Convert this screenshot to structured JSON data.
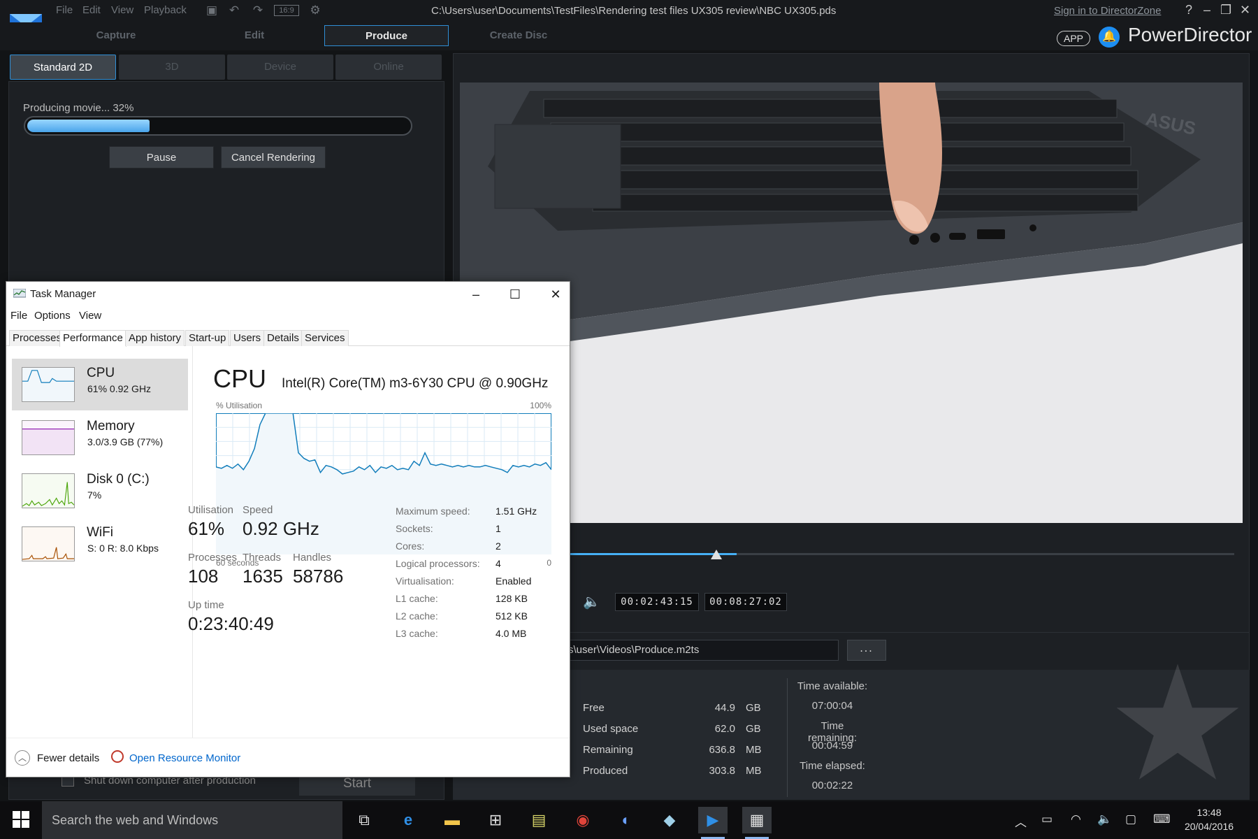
{
  "powerdirector": {
    "menu": [
      "File",
      "Edit",
      "View",
      "Playback"
    ],
    "aspect_ratio": "16:9",
    "file_path": "C:\\Users\\user\\Documents\\TestFiles\\Rendering test files UX305 review\\NBC UX305.pds",
    "sign_in": "Sign in to DirectorZone",
    "help": "?",
    "modes": [
      "Capture",
      "Edit",
      "Produce",
      "Create Disc"
    ],
    "active_mode": "Produce",
    "app_badge": "APP",
    "brand": "PowerDirector",
    "subtabs": [
      "Standard 2D",
      "3D",
      "Device",
      "Online"
    ],
    "progress": {
      "label": "Producing movie... 32%",
      "percent": 32
    },
    "pause_label": "Pause",
    "cancel_label": "Cancel Rendering",
    "shutdown_label": "Shut down computer after production",
    "start_label": "Start",
    "seek_fraction": 0.25,
    "timecode_current": "00:02:43:15",
    "timecode_total": "00:08:27:02",
    "output_path": "s\\user\\Videos\\Produce.m2ts",
    "browse_label": "...",
    "disk_info": [
      {
        "label": "Free",
        "value": "44.9",
        "unit": "GB"
      },
      {
        "label": "Used space",
        "value": "62.0",
        "unit": "GB"
      },
      {
        "label": "Remaining",
        "value": "636.8",
        "unit": "MB"
      },
      {
        "label": "Produced",
        "value": "303.8",
        "unit": "MB"
      }
    ],
    "time_info": [
      {
        "label": "Time available:",
        "value": "07:00:04"
      },
      {
        "label": "Time remaining:",
        "value": "00:04:59"
      },
      {
        "label": "Time elapsed:",
        "value": "00:02:22"
      }
    ]
  },
  "task_manager": {
    "title": "Task Manager",
    "menu": [
      "File",
      "Options",
      "View"
    ],
    "tabs": [
      "Processes",
      "Performance",
      "App history",
      "Start-up",
      "Users",
      "Details",
      "Services"
    ],
    "active_tab": "Performance",
    "sidebar": [
      {
        "name": "CPU",
        "sub": "61%  0.92 GHz",
        "color": "#117dbb"
      },
      {
        "name": "Memory",
        "sub": "3.0/3.9 GB (77%)",
        "color": "#8b12ae"
      },
      {
        "name": "Disk 0 (C:)",
        "sub": "7%",
        "color": "#4da60c"
      },
      {
        "name": "WiFi",
        "sub": "S: 0  R: 8.0 Kbps",
        "color": "#a74f01"
      }
    ],
    "cpu": {
      "title": "CPU",
      "model": "Intel(R) Core(TM) m3-6Y30 CPU @ 0.90GHz",
      "graph_label": "% Utilisation",
      "graph_max": "100%",
      "graph_left": "60 seconds",
      "graph_right": "0",
      "graph_values": [
        62,
        61,
        63,
        61,
        64,
        60,
        66,
        75,
        92,
        100,
        100,
        100,
        100,
        100,
        100,
        72,
        68,
        66,
        67,
        58,
        63,
        62,
        60,
        57,
        58,
        59,
        62,
        60,
        63,
        58,
        62,
        61,
        63,
        60,
        61,
        60,
        66,
        63,
        72,
        64,
        63,
        64,
        63,
        62,
        63,
        62,
        63,
        62,
        62,
        63,
        62,
        61,
        60,
        58,
        63,
        62,
        63,
        62,
        64,
        63,
        65,
        60
      ],
      "stats": [
        {
          "label": "Utilisation",
          "value": "61%"
        },
        {
          "label": "Speed",
          "value": "0.92 GHz"
        },
        {
          "label": "Processes",
          "value": "108"
        },
        {
          "label": "Threads",
          "value": "1635"
        },
        {
          "label": "Handles",
          "value": "58786"
        },
        {
          "label": "Up time",
          "value": "0:23:40:49"
        }
      ],
      "specs": [
        {
          "label": "Maximum speed:",
          "value": "1.51 GHz"
        },
        {
          "label": "Sockets:",
          "value": "1"
        },
        {
          "label": "Cores:",
          "value": "2"
        },
        {
          "label": "Logical processors:",
          "value": "4"
        },
        {
          "label": "Virtualisation:",
          "value": "Enabled"
        },
        {
          "label": "L1 cache:",
          "value": "128 KB"
        },
        {
          "label": "L2 cache:",
          "value": "512 KB"
        },
        {
          "label": "L3 cache:",
          "value": "4.0 MB"
        }
      ]
    },
    "fewer_details": "Fewer details",
    "open_resource_monitor": "Open Resource Monitor"
  },
  "taskbar": {
    "search_placeholder": "Search the web and Windows",
    "time": "13:48",
    "date": "20/04/2016"
  },
  "colors": {
    "accent": "#2f8fd6",
    "progress": "#4aa4ea",
    "cpu_graph": "#117dbb"
  }
}
